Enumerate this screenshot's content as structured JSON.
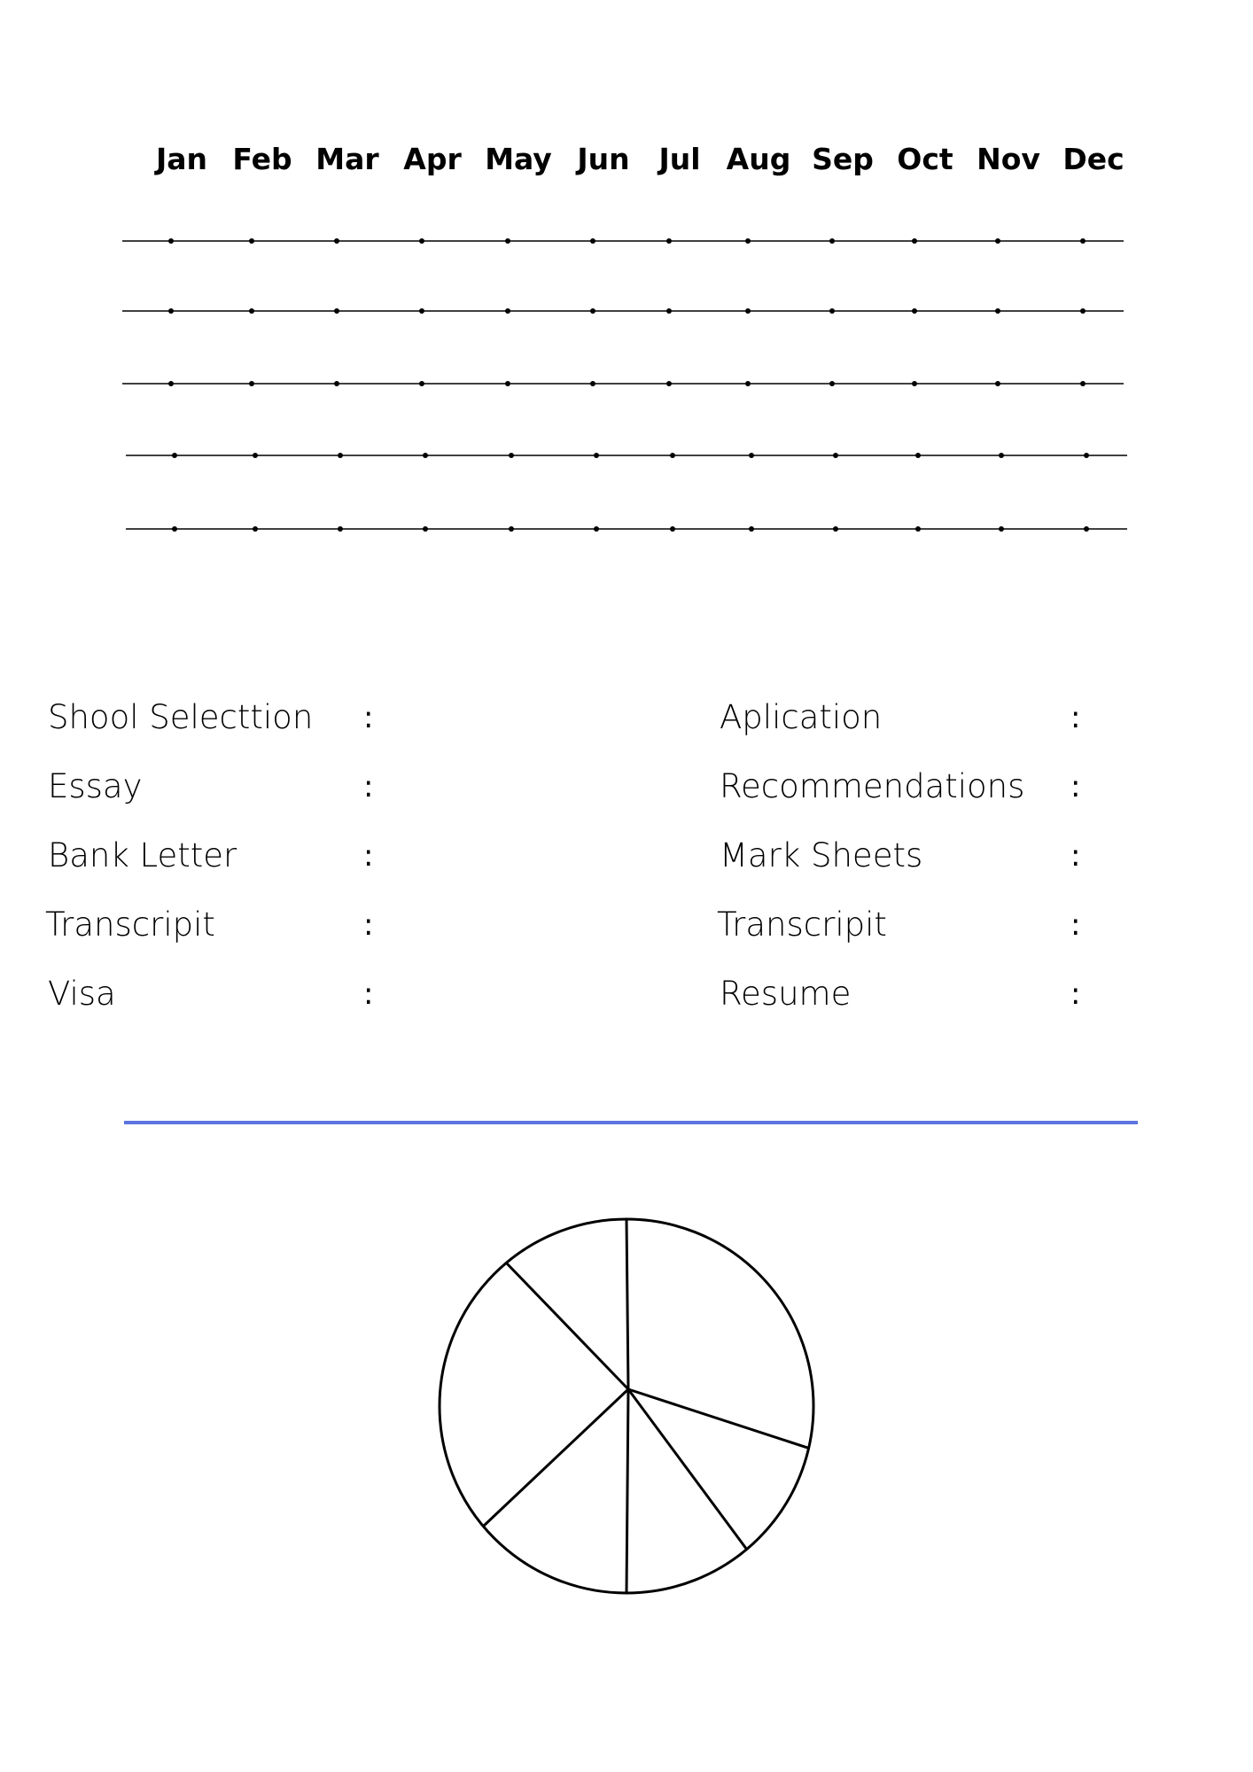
{
  "timeline": {
    "months": [
      "Jan",
      "Feb",
      "Mar",
      "Apr",
      "May",
      "Jun",
      "Jul",
      "Aug",
      "Sep",
      "Oct",
      "Nov",
      "Dec"
    ],
    "row_count": 5
  },
  "fields": {
    "left": [
      {
        "label": "Shool Selecttion",
        "separator": ":"
      },
      {
        "label": "Essay",
        "separator": ":"
      },
      {
        "label": "Bank Letter",
        "separator": ":"
      },
      {
        "label": "Transcripit",
        "separator": ":"
      },
      {
        "label": "Visa",
        "separator": ":"
      }
    ],
    "right": [
      {
        "label": "Aplication",
        "separator": ":"
      },
      {
        "label": "Recommendations",
        "separator": ":"
      },
      {
        "label": "Mark Sheets",
        "separator": ":"
      },
      {
        "label": "Transcripit",
        "separator": ":"
      },
      {
        "label": "Resume",
        "separator": ":"
      }
    ]
  },
  "colors": {
    "divider": "#5b74e1",
    "lines": "#000000"
  },
  "pie": {
    "slice_angles_deg": [
      0,
      103,
      140,
      180,
      230,
      320,
      360
    ]
  }
}
